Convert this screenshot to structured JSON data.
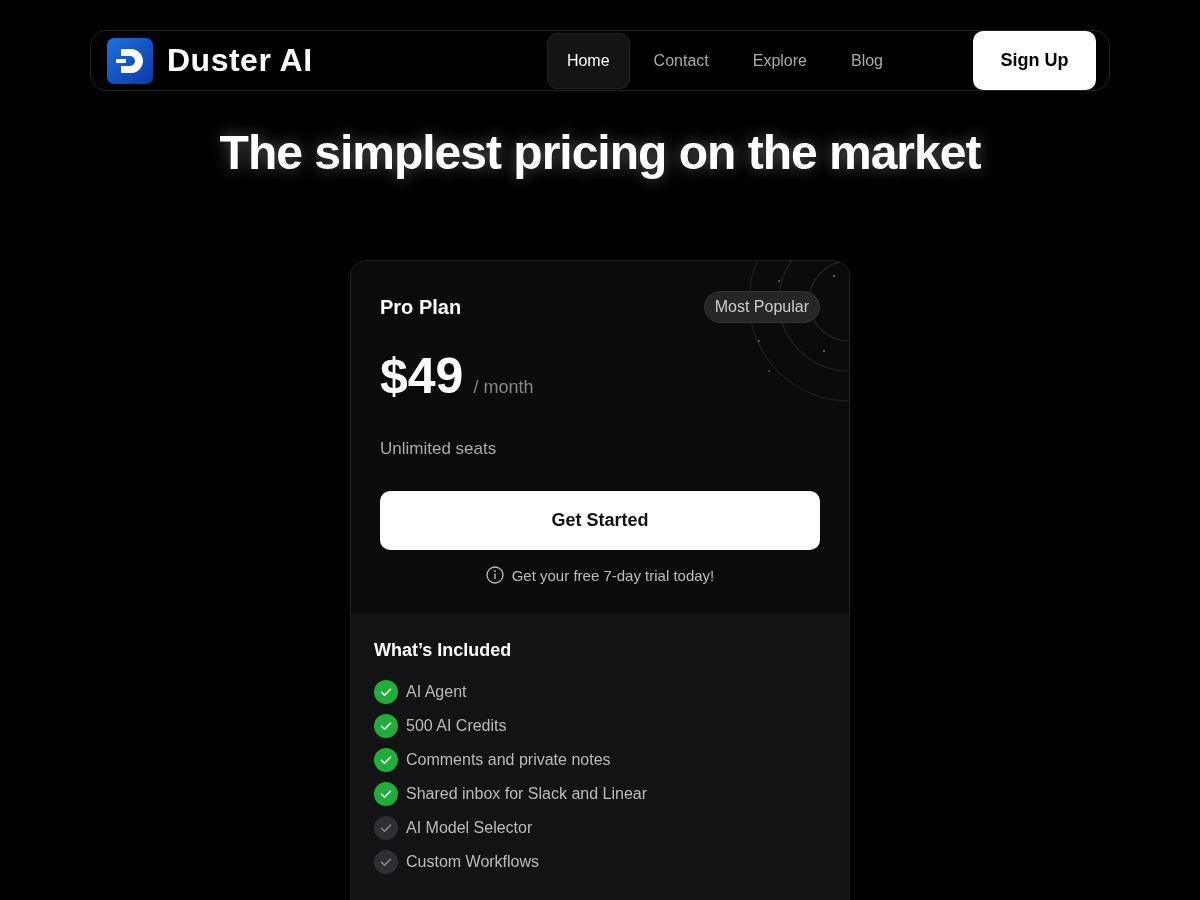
{
  "navbar": {
    "brand": "Duster AI",
    "links": [
      {
        "label": "Home",
        "selected": true
      },
      {
        "label": "Contact",
        "selected": false
      },
      {
        "label": "Explore",
        "selected": false
      },
      {
        "label": "Blog",
        "selected": false
      }
    ],
    "cta": "Sign Up"
  },
  "heading": "The simplest pricing on the market",
  "plan": {
    "name": "Pro Plan",
    "badge": "Most Popular",
    "price": "$49",
    "period": "/ month",
    "seats": "Unlimited seats",
    "button": "Get Started",
    "note": "Get your free 7-day trial today!"
  },
  "included": {
    "title": "What’s Included",
    "features": [
      {
        "label": "AI Agent",
        "included": true
      },
      {
        "label": "500 AI Credits",
        "included": true
      },
      {
        "label": "Comments and private notes",
        "included": true
      },
      {
        "label": "Shared inbox for Slack and Linear",
        "included": true
      },
      {
        "label": "AI Model Selector",
        "included": false
      },
      {
        "label": "Custom Workflows",
        "included": false
      }
    ]
  }
}
